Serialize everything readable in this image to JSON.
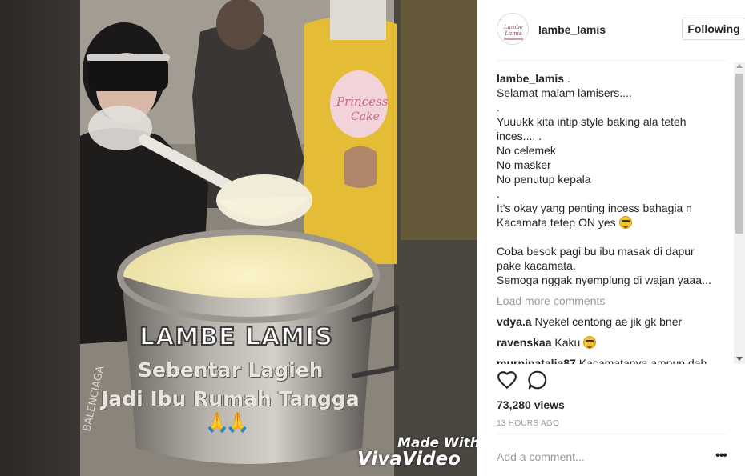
{
  "post": {
    "username": "lambe_lamis",
    "follow_label": "Following",
    "avatar_text": "Lambe Lamis",
    "caption": {
      "user": "lambe_lamis",
      "lines": [
        " .",
        "Selamat malam lamisers....",
        ".",
        "Yuuukk kita intip style baking ala teteh",
        "inces.... .",
        "No celemek",
        "No masker",
        "No penutup kepala",
        ".",
        "It's okay yang penting incess bahagia n",
        "Kacamata tetep ON yes",
        "",
        "Coba besok pagi bu ibu masak di dapur",
        "pake kacamata.",
        "Semoga nggak nyemplung di wajan yaaa..."
      ]
    },
    "load_more": "Load more comments",
    "comments": [
      {
        "user": "vdya.a",
        "text": "Nyekel centong ae jik gk bner"
      },
      {
        "user": "ravenskaa",
        "text": "Kaku"
      },
      {
        "user": "murninatalia87",
        "text": "Kacamatanya ampun dah.."
      }
    ],
    "views": "73,280 views",
    "time": "13 HOURS AGO",
    "comment_placeholder": "Add a comment...",
    "more_label": "•••"
  },
  "media": {
    "overlay_brand": "LAMBE LAMIS",
    "overlay_line2": "Sebentar Lagieh",
    "overlay_line3": "Jadi Ibu Rumah Tangga",
    "overlay_emoji": "🙏🙏",
    "watermark_1": "Made With",
    "watermark_2": "VivaVideo",
    "apron_text_1": "Princess",
    "apron_text_2": "Cake"
  },
  "colors": {
    "text": "#262626",
    "muted": "#999999",
    "border": "#dbdbdb",
    "apron": "#e8c23a"
  },
  "icons": {
    "like": "heart-outline-icon",
    "comment": "speech-bubble-icon",
    "more": "ellipsis-icon"
  }
}
